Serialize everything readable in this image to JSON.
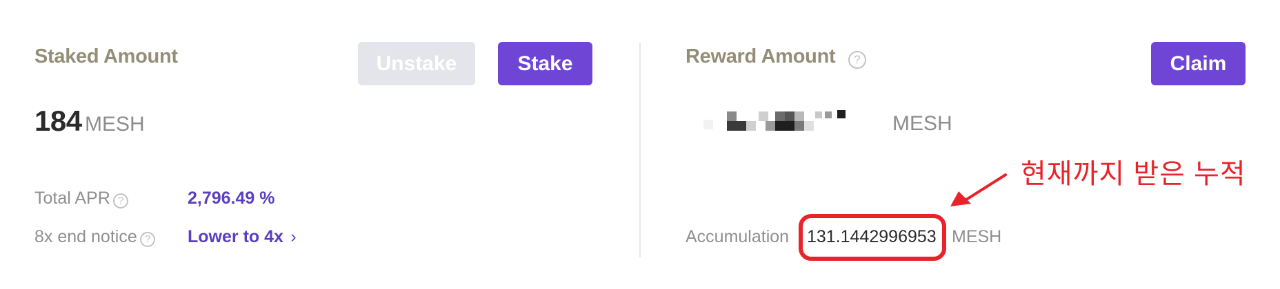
{
  "staked": {
    "title": "Staked Amount",
    "unstake_label": "Unstake",
    "stake_label": "Stake",
    "amount": "184",
    "unit": "MESH",
    "total_apr_label": "Total APR",
    "total_apr_value": "2,796.49 %",
    "end_notice_label": "8x end notice",
    "end_notice_link": "Lower to 4x",
    "help_icon": "?",
    "chevron_icon": "›"
  },
  "reward": {
    "title": "Reward Amount",
    "claim_label": "Claim",
    "unit": "MESH",
    "accumulation_label": "Accumulation",
    "accumulation_value": "131.1442996953",
    "accumulation_unit": "MESH",
    "help_icon": "?"
  },
  "annotation": {
    "text": "현재까지 받은 누적",
    "color": "#e8232a"
  },
  "colors": {
    "accent": "#6f45d6",
    "title": "#968d78",
    "annotation": "#e8232a"
  }
}
